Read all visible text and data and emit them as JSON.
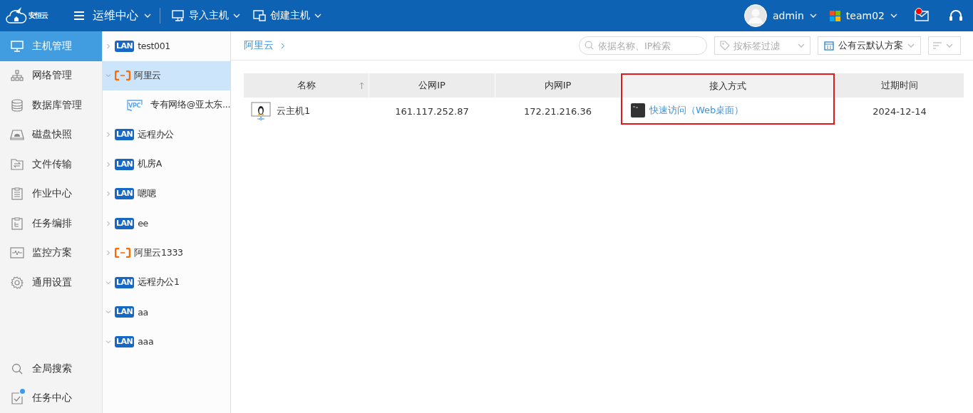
{
  "topbar": {
    "logo_text": "安恒云",
    "module": "运维中心",
    "actions": [
      {
        "label": "导入主机",
        "kind": "import"
      },
      {
        "label": "创建主机",
        "kind": "create"
      }
    ],
    "user": "admin",
    "team": "team02",
    "mail_unread": true
  },
  "sidebar": {
    "items": [
      {
        "label": "主机管理",
        "selected": true
      },
      {
        "label": "网络管理",
        "selected": false
      },
      {
        "label": "数据库管理",
        "selected": false
      },
      {
        "label": "磁盘快照",
        "selected": false
      },
      {
        "label": "文件传输",
        "selected": false
      },
      {
        "label": "作业中心",
        "selected": false
      },
      {
        "label": "任务编排",
        "selected": false
      },
      {
        "label": "监控方案",
        "selected": false
      },
      {
        "label": "通用设置",
        "selected": false
      }
    ],
    "bottom_items": [
      {
        "label": "全局搜索",
        "badge": false
      },
      {
        "label": "任务中心",
        "badge": true
      }
    ]
  },
  "tree": {
    "items": [
      {
        "label": "test001",
        "kind": "lan",
        "tag": "LAN",
        "expanded": false,
        "selected": false
      },
      {
        "label": "阿里云",
        "kind": "cloud",
        "expanded": true,
        "selected": true,
        "children": [
          {
            "label": "专有网络@亚太东...",
            "kind": "vpc",
            "tag": "VPC",
            "selected": false
          }
        ]
      },
      {
        "label": "远程办公",
        "kind": "lan",
        "tag": "LAN",
        "expanded": false,
        "selected": false
      },
      {
        "label": "机房A",
        "kind": "lan",
        "tag": "LAN",
        "expanded": false,
        "selected": false
      },
      {
        "label": "嗯嗯",
        "kind": "lan",
        "tag": "LAN",
        "expanded": false,
        "selected": false
      },
      {
        "label": "ee",
        "kind": "lan",
        "tag": "LAN",
        "expanded": false,
        "selected": false
      },
      {
        "label": "阿里云1333",
        "kind": "cloud",
        "expanded": false,
        "selected": false
      },
      {
        "label": "远程办公1",
        "kind": "lan",
        "tag": "LAN",
        "expanded": true,
        "selected": false
      },
      {
        "label": "aa",
        "kind": "lan",
        "tag": "LAN",
        "expanded": true,
        "selected": false
      },
      {
        "label": "aaa",
        "kind": "lan",
        "tag": "LAN",
        "expanded": true,
        "selected": false
      }
    ]
  },
  "breadcrumb": [
    "阿里云"
  ],
  "toolbar": {
    "search_placeholder": "依据名称、IP检索",
    "tag_filter_placeholder": "按标签过滤",
    "scheme": "公有云默认方案"
  },
  "table": {
    "columns": [
      {
        "label": "名称",
        "sorted_ascending": true,
        "highlighted": false
      },
      {
        "label": "公网IP",
        "highlighted": false
      },
      {
        "label": "内网IP",
        "highlighted": false
      },
      {
        "label": "接入方式",
        "highlighted": true
      },
      {
        "label": "过期时间",
        "highlighted": false
      }
    ],
    "rows": [
      {
        "name": "云主机1",
        "public_ip": "161.117.252.87",
        "private_ip": "172.21.216.36",
        "access": "快速访问（Web桌面）",
        "expires": "2024-12-14"
      }
    ]
  }
}
